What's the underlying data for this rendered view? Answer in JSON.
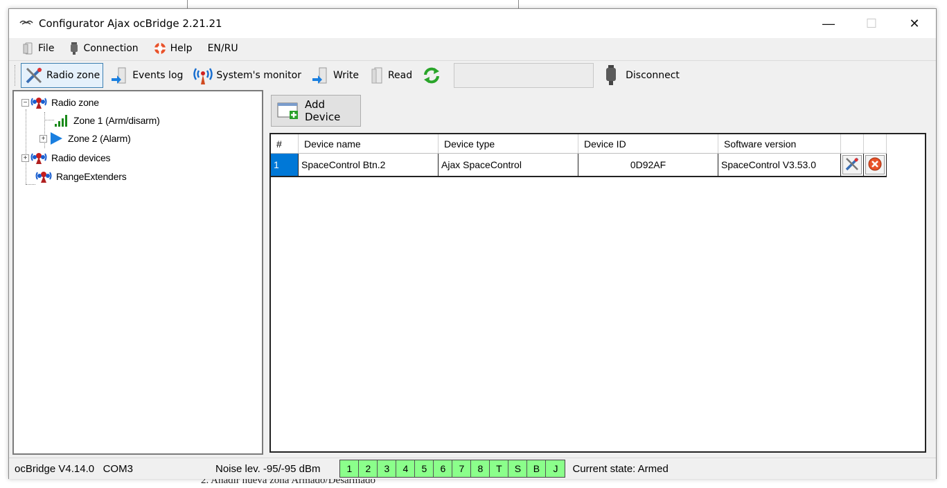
{
  "window": {
    "title": "Configurator Ajax ocBridge 2.21.21",
    "minimize": "—",
    "maximize": "☐",
    "close": "✕"
  },
  "menu": {
    "file": "File",
    "connection": "Connection",
    "help": "Help",
    "lang": "EN/RU"
  },
  "toolbar": {
    "radio_zone": "Radio zone",
    "events_log": "Events log",
    "systems_monitor": "System's monitor",
    "write": "Write",
    "read": "Read",
    "field_value": "",
    "disconnect": "Disconnect"
  },
  "tree": {
    "radio_zone": "Radio zone",
    "zone1": "Zone 1 (Arm/disarm)",
    "zone2": "Zone 2 (Alarm)",
    "radio_devices": "Radio devices",
    "range_extenders": "RangeExtenders"
  },
  "add_device": "Add Device",
  "grid": {
    "headers": {
      "num": "#",
      "name": "Device name",
      "type": "Device type",
      "id": "Device ID",
      "sw": "Software version"
    },
    "rows": [
      {
        "num": "1",
        "name": "SpaceControl Btn.2",
        "type": "Ajax SpaceControl",
        "id": "0D92AF",
        "sw": "SpaceControl V3.53.0"
      }
    ]
  },
  "status": {
    "version": "ocBridge V4.14.0",
    "port": "COM3",
    "noise": "Noise lev.  -95/-95 dBm",
    "zones": [
      "1",
      "2",
      "3",
      "4",
      "5",
      "6",
      "7",
      "8",
      "T",
      "S",
      "B",
      "J"
    ],
    "state": "Current state:  Armed",
    "zone_color": "#8bff8b"
  },
  "background_text": "2.    Añadir nueva zona Armado/Desarmado"
}
